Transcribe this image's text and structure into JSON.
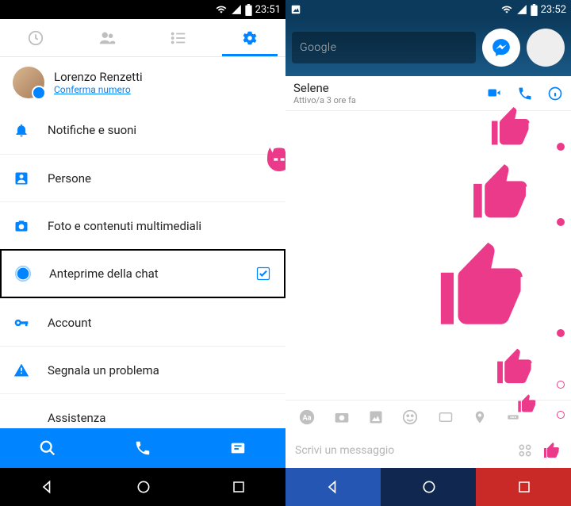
{
  "left": {
    "status": {
      "time": "23:51"
    },
    "profile": {
      "name": "Lorenzo Renzetti",
      "confirm": "Conferma numero"
    },
    "rows": {
      "notifications": "Notifiche e suoni",
      "people": "Persone",
      "media": "Foto e contenuti multimediali",
      "previews": "Anteprime della chat",
      "account": "Account",
      "report": "Segnala un problema",
      "help": "Assistenza"
    }
  },
  "right": {
    "status": {
      "time": "23:52"
    },
    "search": "Google",
    "chat": {
      "name": "Selene",
      "status": "Attivo/a 3 ore fa"
    },
    "compose": {
      "placeholder": "Scrivi un messaggio"
    }
  }
}
